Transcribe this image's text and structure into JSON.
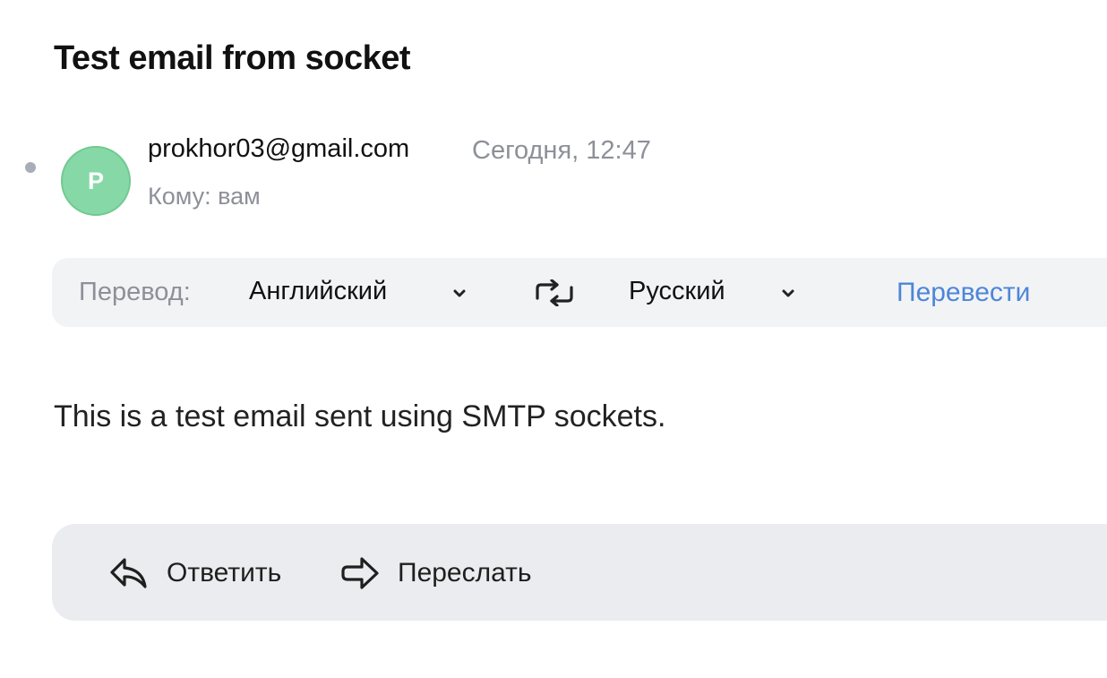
{
  "message": {
    "subject": "Test email from socket",
    "sender": "prokhor03@gmail.com",
    "date": "Сегодня, 12:47",
    "recipient": "Кому: вам",
    "avatar_letter": "P",
    "avatar_color": "#86d9a7",
    "unread": true,
    "body": "This is a test email sent using SMTP sockets."
  },
  "translation": {
    "label": "Перевод:",
    "from_language": "Английский",
    "to_language": "Русский",
    "translate_button": "Перевести",
    "link_color": "#4d86d9"
  },
  "actions": {
    "reply_label": "Ответить",
    "forward_label": "Переслать",
    "reply_icon": "reply-icon",
    "forward_icon": "forward-icon"
  }
}
